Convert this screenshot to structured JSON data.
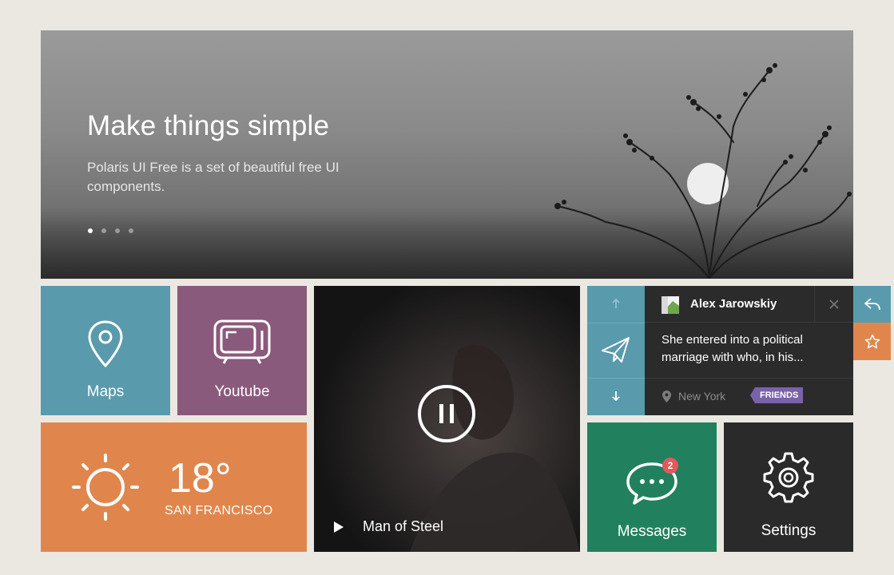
{
  "hero": {
    "title": "Make things simple",
    "subtitle": "Polaris UI Free is a set of beautiful free UI components.",
    "slide_count": 4,
    "active_slide": 1
  },
  "tiles": {
    "maps": {
      "label": "Maps",
      "icon": "map-pin-icon",
      "color": "#5a9aad"
    },
    "youtube": {
      "label": "Youtube",
      "icon": "tv-icon",
      "color": "#8a5a7c"
    },
    "weather": {
      "temperature": "18°",
      "city": "SAN FRANCISCO",
      "icon": "sun-icon",
      "color": "#e0864d"
    },
    "video": {
      "title": "Man of Steel",
      "icon": "pause-icon"
    },
    "messages": {
      "label": "Messages",
      "count": "2",
      "icon": "chat-bubble-icon",
      "color": "#21815e"
    },
    "settings": {
      "label": "Settings",
      "icon": "gear-icon",
      "color": "#2a2a2a"
    }
  },
  "message_card": {
    "author": "Alex Jarowskiy",
    "text": "She entered into a political marriage with who, in his...",
    "location": "New York",
    "badge": "FRIENDS",
    "badge_color": "#7a62a8"
  }
}
